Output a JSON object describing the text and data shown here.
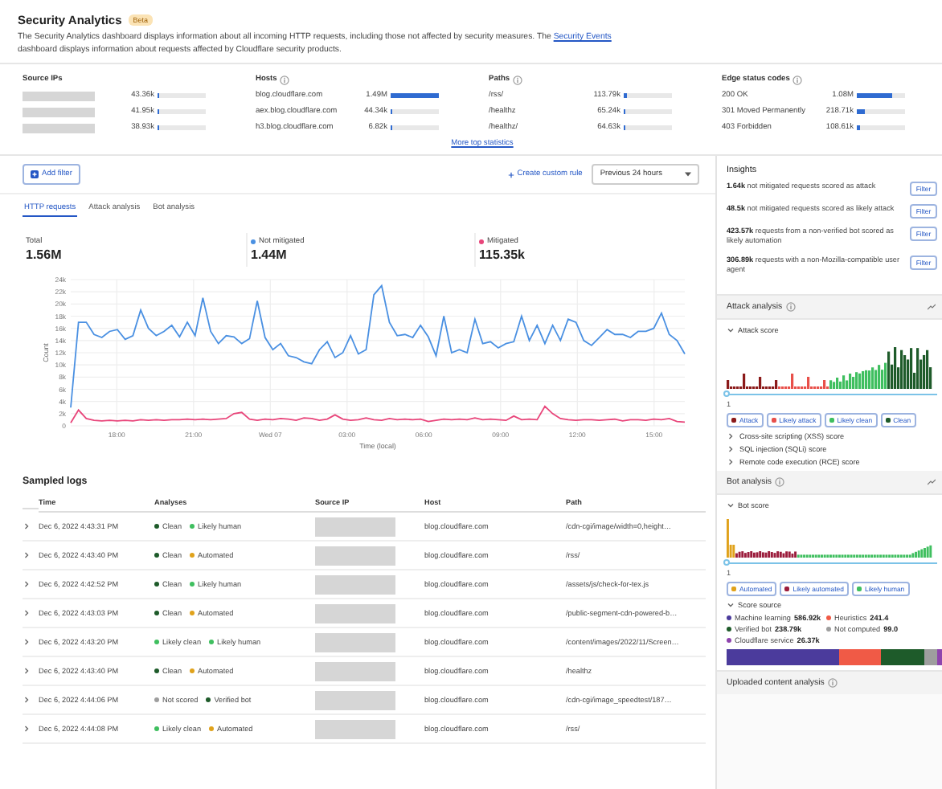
{
  "header": {
    "title": "Security Analytics",
    "badge": "Beta",
    "description": {
      "before": "The Security Analytics dashboard displays information about all incoming HTTP requests, including those not affected by security measures. The ",
      "link": "Security Events",
      "after": " dashboard displays information about requests affected by Cloudflare security products."
    }
  },
  "top_stats": {
    "columns": [
      {
        "title": "Source IPs",
        "info": false,
        "rows": [
          {
            "redacted": true,
            "value": "43.36k",
            "level": 0.03
          },
          {
            "redacted": true,
            "value": "41.95k",
            "level": 0.03
          },
          {
            "redacted": true,
            "value": "38.93k",
            "level": 0.03
          }
        ]
      },
      {
        "title": "Hosts",
        "info": true,
        "rows": [
          {
            "label": "blog.cloudflare.com",
            "value": "1.49M",
            "level": 1
          },
          {
            "label": "aex.blog.cloudflare.com",
            "value": "44.34k",
            "level": 0.03
          },
          {
            "label": "h3.blog.cloudflare.com",
            "value": "6.82k",
            "level": 0.01
          }
        ]
      },
      {
        "title": "Paths",
        "info": true,
        "rows": [
          {
            "label": "/rss/",
            "value": "113.79k",
            "level": 0.08
          },
          {
            "label": "/healthz",
            "value": "65.24k",
            "level": 0.04
          },
          {
            "label": "/healthz/",
            "value": "64.63k",
            "level": 0.04
          }
        ]
      },
      {
        "title": "Edge status codes",
        "info": true,
        "rows": [
          {
            "label": "200 OK",
            "value": "1.08M",
            "level": 0.72
          },
          {
            "label": "301 Moved Permanently",
            "value": "218.71k",
            "level": 0.15
          },
          {
            "label": "403 Forbidden",
            "value": "108.61k",
            "level": 0.07
          }
        ]
      }
    ],
    "more_link": "More top statistics"
  },
  "toolbar": {
    "add_filter": "Add filter",
    "create_rule": "Create custom rule",
    "time_range": "Previous 24 hours"
  },
  "tabs": [
    {
      "label": "HTTP requests",
      "selected": true
    },
    {
      "label": "Attack analysis",
      "selected": false
    },
    {
      "label": "Bot analysis",
      "selected": false
    }
  ],
  "totals": [
    {
      "label": "Total",
      "value": "1.56M"
    },
    {
      "value": "1.44M"
    },
    {
      "value": "115.35k"
    }
  ],
  "traffic": {
    "x_axis_labels": [
      "18:00",
      "21:00",
      "Wed 07",
      "03:00",
      "06:00",
      "09:00",
      "12:00",
      "15:00"
    ],
    "chart_data": {
      "type": "line",
      "grid": true,
      "xlabel": "Time (local)",
      "ylabel": "Count",
      "ylim": [
        0,
        24000
      ],
      "yticks": [
        {
          "value": 0,
          "label": "0"
        },
        {
          "value": 2000,
          "label": "2k"
        },
        {
          "value": 4000,
          "label": "4k"
        },
        {
          "value": 6000,
          "label": "6k"
        },
        {
          "value": 8000,
          "label": "8k"
        },
        {
          "value": 10000,
          "label": "10k"
        },
        {
          "value": 12000,
          "label": "12k"
        },
        {
          "value": 14000,
          "label": "14k"
        },
        {
          "value": 16000,
          "label": "16k"
        },
        {
          "value": 18000,
          "label": "18k"
        },
        {
          "value": 20000,
          "label": "20k"
        },
        {
          "value": 22000,
          "label": "22k"
        },
        {
          "value": 24000,
          "label": "24k"
        }
      ],
      "series": [
        {
          "name": "Not mitigated",
          "color": "#4a90e2",
          "values": [
            3000,
            17000,
            17000,
            15000,
            14500,
            15500,
            15800,
            14200,
            14800,
            19000,
            16000,
            14800,
            15500,
            16500,
            14600,
            17000,
            14800,
            21000,
            15500,
            13500,
            14800,
            14600,
            13500,
            14300,
            20500,
            14500,
            12500,
            13500,
            11500,
            11200,
            10500,
            10200,
            12500,
            13800,
            11200,
            12000,
            14800,
            11800,
            12500,
            21500,
            23000,
            17000,
            14800,
            15000,
            14500,
            16500,
            14600,
            11500,
            18000,
            12000,
            12500,
            12000,
            17500,
            13500,
            13800,
            12800,
            13500,
            13800,
            18000,
            14000,
            16500,
            13500,
            16500,
            14000,
            17500,
            17000,
            14000,
            13200,
            14500,
            15800,
            15000,
            15000,
            14500,
            15500,
            15500,
            16000,
            18500,
            15000,
            14000,
            11800
          ]
        },
        {
          "name": "Mitigated",
          "color": "#e8457a",
          "values": [
            500,
            2600,
            1200,
            900,
            800,
            900,
            800,
            900,
            800,
            1000,
            900,
            1000,
            900,
            1000,
            1000,
            1100,
            1000,
            1100,
            1000,
            1100,
            1200,
            2000,
            2200,
            1100,
            900,
            1100,
            1000,
            1200,
            1100,
            900,
            1300,
            1200,
            900,
            1100,
            1800,
            1100,
            900,
            1000,
            1300,
            1000,
            900,
            1200,
            1000,
            1100,
            1000,
            1100,
            700,
            900,
            1100,
            1000,
            1100,
            1000,
            1300,
            1000,
            1100,
            1000,
            900,
            1600,
            1000,
            1100,
            1000,
            3200,
            2000,
            1200,
            1000,
            900,
            1000,
            1000,
            900,
            1000,
            1100,
            800,
            1000,
            1000,
            900,
            1100,
            1000,
            1200,
            700,
            600
          ]
        }
      ]
    }
  },
  "logs": {
    "title": "Sampled logs",
    "columns": [
      "Time",
      "Analyses",
      "Source IP",
      "Host",
      "Path"
    ],
    "rows": [
      {
        "time": "Dec 6, 2022 4:43:31 PM",
        "analyses": [
          {
            "label": "Clean",
            "color": "#1e5b2a"
          },
          {
            "label": "Likely human",
            "color": "#3fbf5f"
          }
        ],
        "source_ip_redacted": true,
        "host": "blog.cloudflare.com",
        "path": "/cdn-cgi/image/width=0,height…"
      },
      {
        "time": "Dec 6, 2022 4:43:40 PM",
        "analyses": [
          {
            "label": "Clean",
            "color": "#1e5b2a"
          },
          {
            "label": "Automated",
            "color": "#e0a21b"
          }
        ],
        "source_ip_redacted": true,
        "host": "blog.cloudflare.com",
        "path": "/rss/"
      },
      {
        "time": "Dec 6, 2022 4:42:52 PM",
        "analyses": [
          {
            "label": "Clean",
            "color": "#1e5b2a"
          },
          {
            "label": "Likely human",
            "color": "#3fbf5f"
          }
        ],
        "source_ip_redacted": true,
        "host": "blog.cloudflare.com",
        "path": "/assets/js/check-for-tex.js"
      },
      {
        "time": "Dec 6, 2022 4:43:03 PM",
        "analyses": [
          {
            "label": "Clean",
            "color": "#1e5b2a"
          },
          {
            "label": "Automated",
            "color": "#e0a21b"
          }
        ],
        "source_ip_redacted": true,
        "host": "blog.cloudflare.com",
        "path": "/public-segment-cdn-powered-b…"
      },
      {
        "time": "Dec 6, 2022 4:43:20 PM",
        "analyses": [
          {
            "label": "Likely clean",
            "color": "#3fbf5f"
          },
          {
            "label": "Likely human",
            "color": "#3fbf5f"
          }
        ],
        "source_ip_redacted": true,
        "host": "blog.cloudflare.com",
        "path": "/content/images/2022/11/Screen…"
      },
      {
        "time": "Dec 6, 2022 4:43:40 PM",
        "analyses": [
          {
            "label": "Clean",
            "color": "#1e5b2a"
          },
          {
            "label": "Automated",
            "color": "#e0a21b"
          }
        ],
        "source_ip_redacted": true,
        "host": "blog.cloudflare.com",
        "path": "/healthz"
      },
      {
        "time": "Dec 6, 2022 4:44:06 PM",
        "analyses": [
          {
            "label": "Not scored",
            "color": "#9e9e9e"
          },
          {
            "label": "Verified bot",
            "color": "#1e5b2a"
          }
        ],
        "source_ip_redacted": true,
        "host": "blog.cloudflare.com",
        "path": "/cdn-cgi/image_speedtest/187…"
      },
      {
        "time": "Dec 6, 2022 4:44:08 PM",
        "analyses": [
          {
            "label": "Likely clean",
            "color": "#3fbf5f"
          },
          {
            "label": "Automated",
            "color": "#e0a21b"
          }
        ],
        "source_ip_redacted": true,
        "host": "blog.cloudflare.com",
        "path": "/rss/"
      }
    ]
  },
  "insights": {
    "title": "Insights",
    "items": [
      {
        "text": "**1.64k** not mitigated requests scored as attack",
        "button": "Filter"
      },
      {
        "text": "**48.5k** not mitigated requests scored as likely attack",
        "button": "Filter"
      },
      {
        "text": "**423.57k** requests from a non-verified bot scored as likely automation",
        "button": "Filter"
      },
      {
        "text": "**306.89k** requests with a non-Mozilla-compatible user agent",
        "button": "Filter"
      }
    ]
  },
  "attack_analysis": {
    "title": "Attack analysis",
    "score_title": "Attack score",
    "slider": {
      "label": "1",
      "level": 0
    },
    "legend": [
      {
        "label": "Attack",
        "color": "#8b1a1a"
      },
      {
        "label": "Likely attack",
        "color": "#e8504a"
      },
      {
        "label": "Likely clean",
        "color": "#3fbf5f"
      },
      {
        "label": "Clean",
        "color": "#1e5b2a"
      }
    ],
    "sections": [
      {
        "label": "Cross-site scripting (XSS) score",
        "expanded": false
      },
      {
        "label": "SQL injection (SQLi) score",
        "expanded": false
      },
      {
        "label": "Remote code execution (RCE) score",
        "expanded": false
      }
    ]
  },
  "bot_analysis": {
    "title": "Bot analysis",
    "score_title": "Bot score",
    "slider": {
      "label": "1",
      "level": 0
    },
    "legend": [
      {
        "label": "Automated",
        "color": "#e0a21b"
      },
      {
        "label": "Likely automated",
        "color": "#9b1c3c"
      },
      {
        "label": "Likely human",
        "color": "#3fbf5f"
      }
    ],
    "source_title": "Score source",
    "sources": [
      {
        "label": "Machine learning",
        "value": "586.92k",
        "color": "#4b3b9c"
      },
      {
        "label": "Heuristics",
        "value": "241.4",
        "color": "#f05a46"
      },
      {
        "label": "Verified bot",
        "value": "238.79k",
        "color": "#1e5b2a"
      },
      {
        "label": "Not computed",
        "value": "99.0",
        "color": "#9e9e9e"
      },
      {
        "label": "Cloudflare service",
        "value": "26.37k",
        "color": "#8e44ad"
      }
    ]
  },
  "uploaded": {
    "title": "Uploaded content analysis"
  }
}
